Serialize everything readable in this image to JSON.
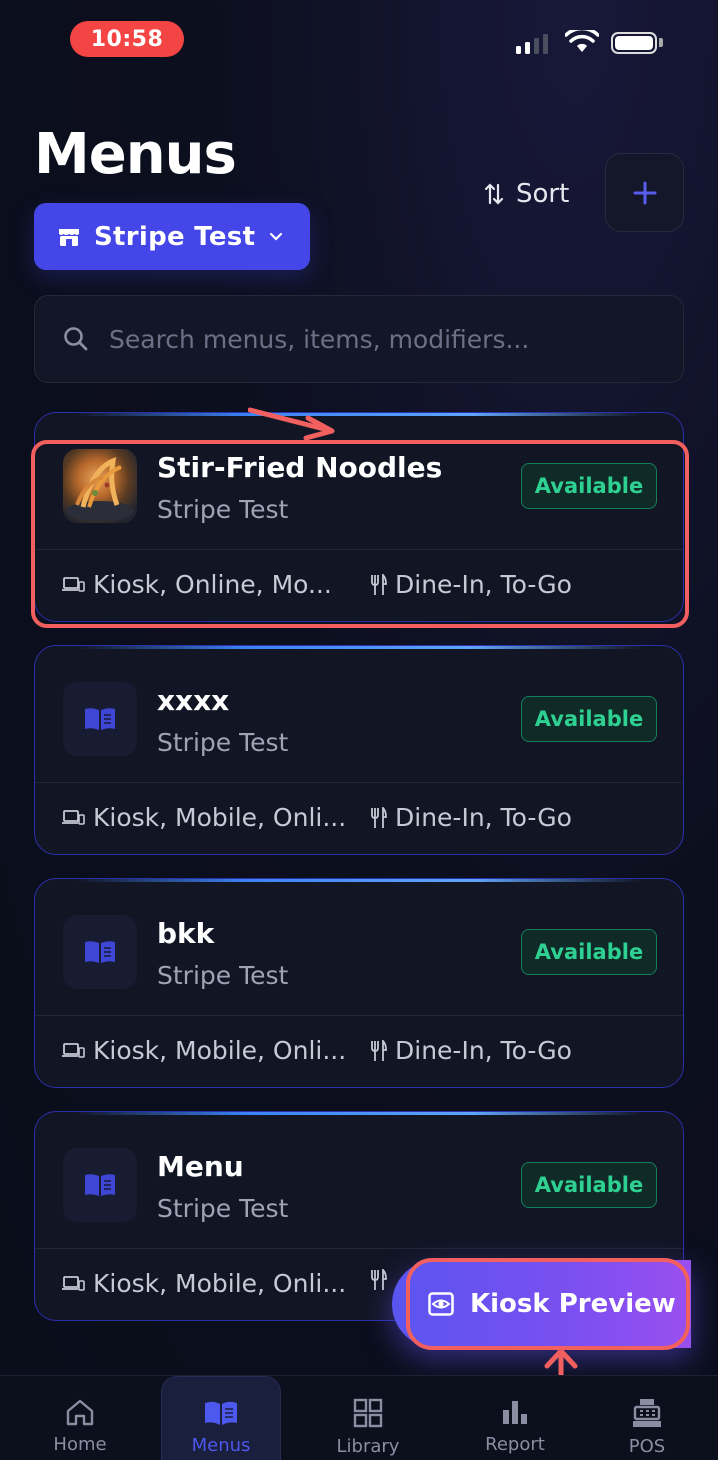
{
  "status_bar": {
    "time": "10:58"
  },
  "header": {
    "title": "Menus",
    "store_selector": "Stripe Test",
    "sort_label": "Sort"
  },
  "search": {
    "placeholder": "Search menus, items, modifiers..."
  },
  "menus": [
    {
      "name": "Stir-Fried Noodles",
      "store": "Stripe Test",
      "status": "Available",
      "channels": "Kiosk, Online, Mo...",
      "service": "Dine-In, To-Go",
      "thumb": "food-photo"
    },
    {
      "name": "xxxx",
      "store": "Stripe Test",
      "status": "Available",
      "channels": "Kiosk, Mobile, Onli...",
      "service": "Dine-In, To-Go",
      "thumb": "book-icon"
    },
    {
      "name": "bkk",
      "store": "Stripe Test",
      "status": "Available",
      "channels": "Kiosk, Mobile, Onli...",
      "service": "Dine-In, To-Go",
      "thumb": "book-icon"
    },
    {
      "name": "Menu",
      "store": "Stripe Test",
      "status": "Available",
      "channels": "Kiosk, Mobile, Onli...",
      "service": "",
      "thumb": "book-icon"
    }
  ],
  "kiosk_preview": {
    "label": "Kiosk Preview"
  },
  "tabs": [
    {
      "label": "Home",
      "icon": "home-icon"
    },
    {
      "label": "Menus",
      "icon": "book-icon",
      "active": true
    },
    {
      "label": "Library",
      "icon": "grid-icon"
    },
    {
      "label": "Report",
      "icon": "bar-chart-icon"
    },
    {
      "label": "POS",
      "icon": "cash-register-icon"
    }
  ],
  "colors": {
    "accent": "#4446e8",
    "available": "#2ed191",
    "highlight": "#f25f5f"
  }
}
